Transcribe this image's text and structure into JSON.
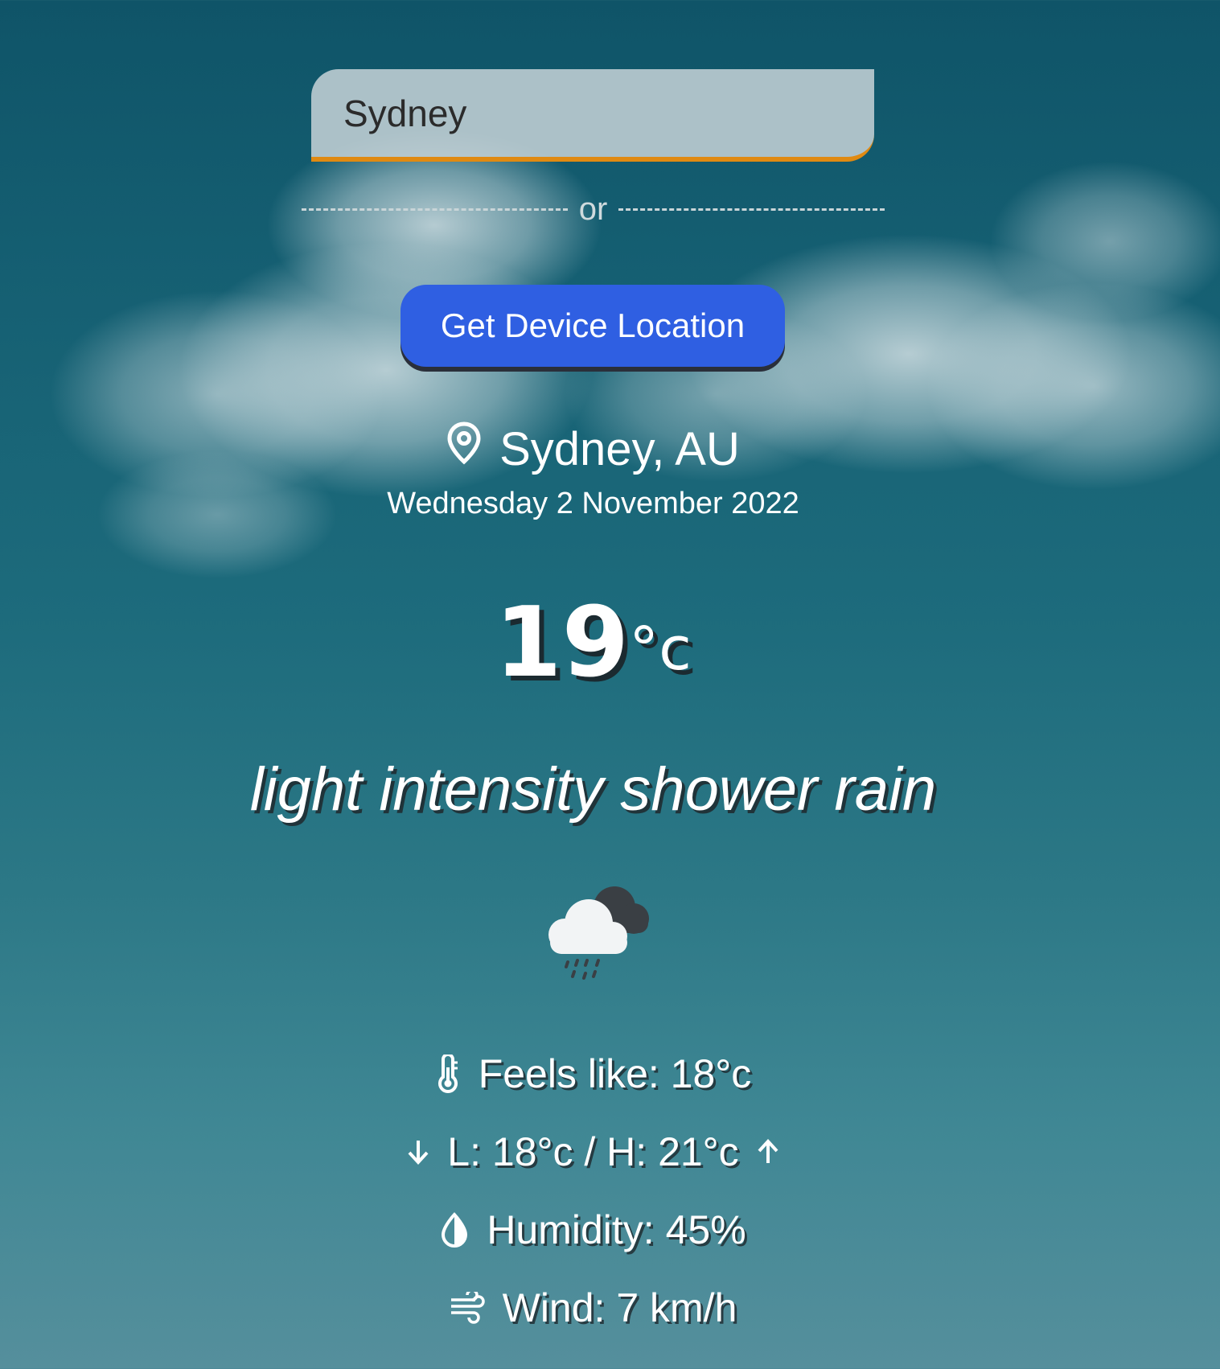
{
  "search": {
    "value": "Sydney"
  },
  "divider": {
    "label": "or"
  },
  "location_button": {
    "label": "Get Device Location"
  },
  "location": {
    "city": "Sydney, AU",
    "date": "Wednesday 2 November 2022"
  },
  "temperature": {
    "value": "19",
    "unit": "°c"
  },
  "description": "light intensity shower rain",
  "weather_icon": "cloud-rain-icon",
  "stats": {
    "feels_like": "Feels like: 18°c",
    "low_high": "L: 18°c / H: 21°c",
    "humidity": "Humidity: 45%",
    "wind": "Wind: 7 km/h"
  },
  "icons": {
    "location": "map-pin-icon",
    "feels_like": "thermometer-icon",
    "low": "arrow-down-icon",
    "high": "arrow-up-icon",
    "humidity": "droplet-icon",
    "wind": "wind-icon"
  },
  "colors": {
    "button": "#2f5fe2",
    "search_border": "#e08a12",
    "background_top": "#0f5468",
    "background_bottom": "#558f9c"
  }
}
